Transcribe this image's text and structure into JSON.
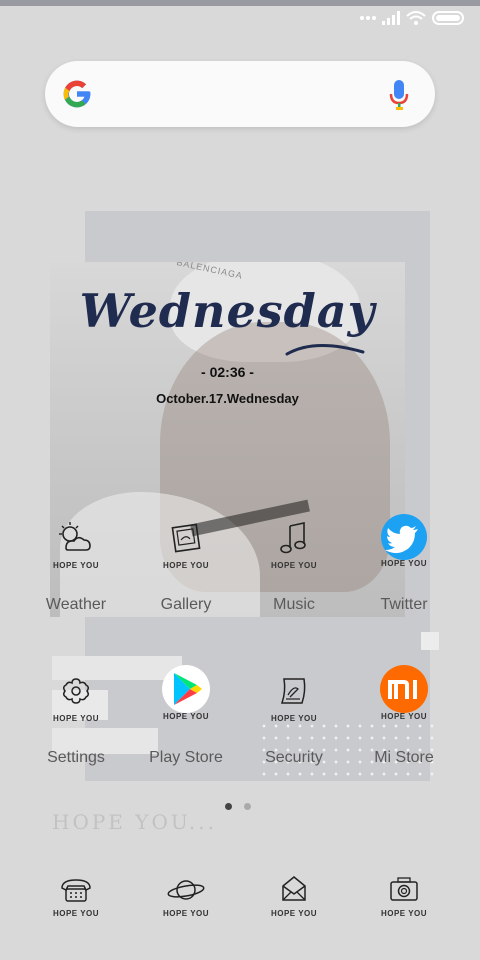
{
  "status_bar": {
    "icons": [
      "signal-dots-icon",
      "cellular-signal-icon",
      "wifi-icon",
      "battery-icon"
    ]
  },
  "search_bar": {
    "logo_icon": "google-g-icon",
    "mic_icon": "microphone-icon"
  },
  "widget": {
    "weekday": "Wednesday",
    "time": "- 02:36 -",
    "date": "October.17.Wednesday",
    "photo_brand": "BALENCIAGA"
  },
  "apps_row1": [
    {
      "name": "Weather",
      "tag": "HOPE YOU",
      "icon": "weather-icon"
    },
    {
      "name": "Gallery",
      "tag": "HOPE YOU",
      "icon": "gallery-icon"
    },
    {
      "name": "Music",
      "tag": "HOPE YOU",
      "icon": "music-note-icon"
    },
    {
      "name": "Twitter",
      "tag": "HOPE YOU",
      "icon": "twitter-bird-icon"
    }
  ],
  "apps_row2": [
    {
      "name": "Settings",
      "tag": "HOPE YOU",
      "icon": "settings-gear-icon"
    },
    {
      "name": "Play Store",
      "tag": "HOPE YOU",
      "icon": "play-store-icon"
    },
    {
      "name": "Security",
      "tag": "HOPE YOU",
      "icon": "security-icon"
    },
    {
      "name": "Mi Store",
      "tag": "HOPE YOU",
      "icon": "mi-store-icon"
    }
  ],
  "pager": {
    "pages": 2,
    "active": 0
  },
  "decor_text": "HOPE YOU...",
  "dock": [
    {
      "tag": "HOPE YOU",
      "icon": "phone-icon"
    },
    {
      "tag": "HOPE YOU",
      "icon": "planet-icon"
    },
    {
      "tag": "HOPE YOU",
      "icon": "mail-envelope-icon"
    },
    {
      "tag": "HOPE YOU",
      "icon": "camera-icon"
    }
  ],
  "colors": {
    "weekday_ink": "#1f2b4f",
    "twitter_blue": "#1da1f2",
    "mi_orange": "#ff6a00"
  }
}
